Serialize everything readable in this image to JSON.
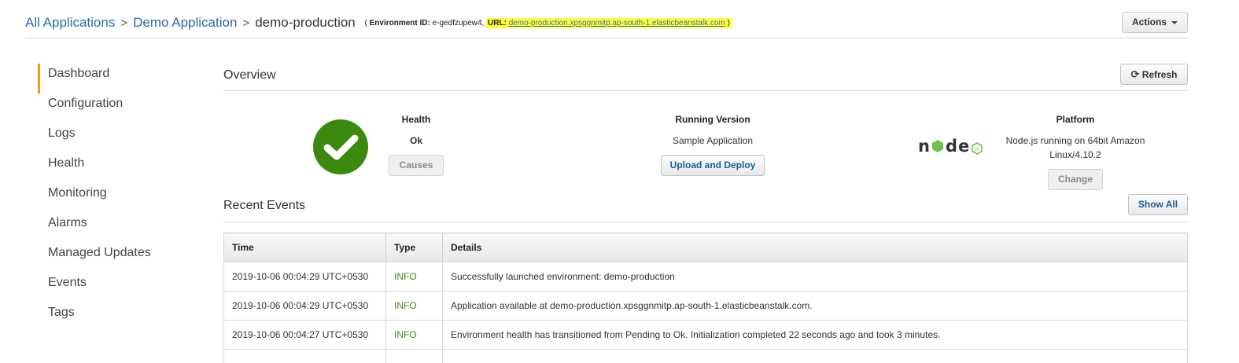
{
  "breadcrumb": {
    "all_apps": "All Applications",
    "app": "Demo Application",
    "env": "demo-production",
    "env_id_prefix": "( ",
    "env_id_label": "Environment ID:",
    "env_id_value": " e-gedfzupew4, ",
    "url_label": "URL:",
    "url_value": "demo-production.xpsggnmitp.ap-south-1.elasticbeanstalk.com",
    "close_paren": " )",
    "sep": ">"
  },
  "actions_label": "Actions",
  "sidebar": {
    "items": [
      {
        "label": "Dashboard"
      },
      {
        "label": "Configuration"
      },
      {
        "label": "Logs"
      },
      {
        "label": "Health"
      },
      {
        "label": "Monitoring"
      },
      {
        "label": "Alarms"
      },
      {
        "label": "Managed Updates"
      },
      {
        "label": "Events"
      },
      {
        "label": "Tags"
      }
    ]
  },
  "overview": {
    "title": "Overview",
    "refresh_label": "Refresh",
    "health": {
      "heading": "Health",
      "value": "Ok",
      "causes_label": "Causes"
    },
    "running_version": {
      "heading": "Running Version",
      "value": "Sample Application",
      "button": "Upload and Deploy"
    },
    "platform": {
      "heading": "Platform",
      "value_line1": "Node.js running on 64bit Amazon",
      "value_line2": "Linux/4.10.2",
      "button": "Change"
    }
  },
  "events": {
    "title": "Recent Events",
    "show_all_label": "Show All",
    "columns": [
      "Time",
      "Type",
      "Details"
    ],
    "rows": [
      {
        "time": "2019-10-06 00:04:29 UTC+0530",
        "type": "INFO",
        "details": "Successfully launched environment: demo-production"
      },
      {
        "time": "2019-10-06 00:04:29 UTC+0530",
        "type": "INFO",
        "details": "Application available at demo-production.xpsggnmitp.ap-south-1.elasticbeanstalk.com."
      },
      {
        "time": "2019-10-06 00:04:27 UTC+0530",
        "type": "INFO",
        "details": "Environment health has transitioned from Pending to Ok. Initialization completed 22 seconds ago and took 3 minutes."
      }
    ]
  },
  "colors": {
    "accent": "#f39c12",
    "health_green": "#3a8a0f",
    "info_green": "#3d8a13",
    "link_blue": "#2d6aa8",
    "highlight": "#ffff3a"
  }
}
